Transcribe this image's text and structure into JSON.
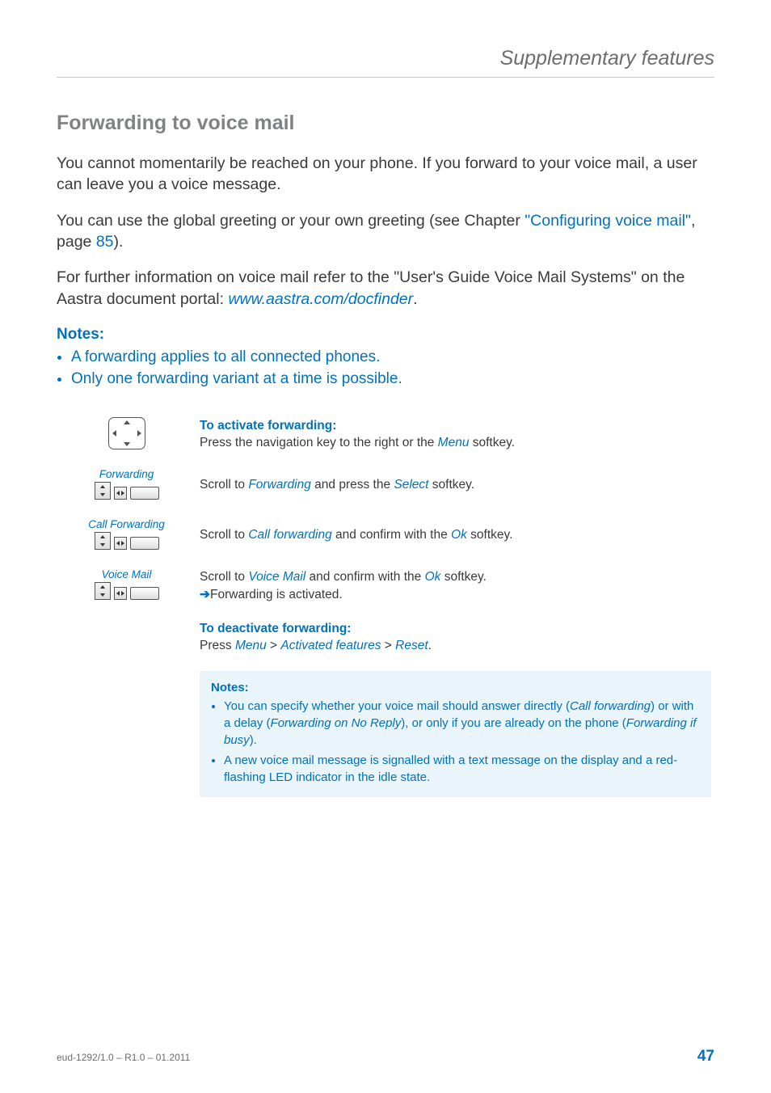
{
  "header": {
    "chapter": "Supplementary features"
  },
  "section": {
    "title": "Forwarding to voice mail"
  },
  "paragraphs": {
    "p1": "You cannot momentarily be reached on your phone. If you forward to your voice mail, a user can leave you a voice message.",
    "p2a": "You can use the global greeting or your own greeting (see Chapter ",
    "p2link": "\"Configuring voice mail\"",
    "p2b": ", page ",
    "p2page": "85",
    "p2c": ").",
    "p3a": "For further information on voice mail refer to the \"User's Guide Voice Mail Systems\" on the Aastra document portal: ",
    "p3link": "www.aastra.com/docfinder",
    "p3b": "."
  },
  "topnotes": {
    "label": "Notes:",
    "items": [
      "A forwarding applies to all connected phones.",
      "Only one forwarding variant at a time is possible."
    ]
  },
  "steps": {
    "row1": {
      "title": "To activate forwarding:",
      "text_a": "Press the navigation key to the right or the ",
      "menu": "Menu",
      "text_b": " softkey."
    },
    "row2": {
      "label": "Forwarding",
      "text_a": "Scroll to ",
      "kw": "Forwarding",
      "text_b": " and press the ",
      "select": "Select",
      "text_c": " softkey."
    },
    "row3": {
      "label": "Call Forwarding",
      "text_a": "Scroll to ",
      "kw": "Call forwarding",
      "text_b": " and confirm with the ",
      "ok": "Ok",
      "text_c": " softkey."
    },
    "row4": {
      "label": "Voice Mail",
      "text_a": "Scroll to ",
      "kw": "Voice Mail",
      "text_b": " and confirm with the ",
      "ok": "Ok",
      "text_c": " softkey.",
      "arrow": "➔",
      "result": "Forwarding is activated."
    },
    "row5": {
      "title": "To deactivate forwarding:",
      "text_a": "Press ",
      "m1": "Menu",
      "gt1": " > ",
      "m2": "Activated features",
      "gt2": " > ",
      "m3": "Reset",
      "text_b": "."
    }
  },
  "bottomnotes": {
    "label": "Notes:",
    "n1a": "You can specify whether your voice mail should answer directly (",
    "n1k1": "Call forwarding",
    "n1b": ") or with a delay (",
    "n1k2": "Forwarding on No Reply",
    "n1c": "), or only if you are already on the phone (",
    "n1k3": "Forwarding if busy",
    "n1d": ").",
    "n2": "A new voice mail message is signalled with a text message on the display and a red-flashing LED indicator in the idle state."
  },
  "footer": {
    "docid": "eud-1292/1.0 – R1.0 – 01.2011",
    "page": "47"
  }
}
